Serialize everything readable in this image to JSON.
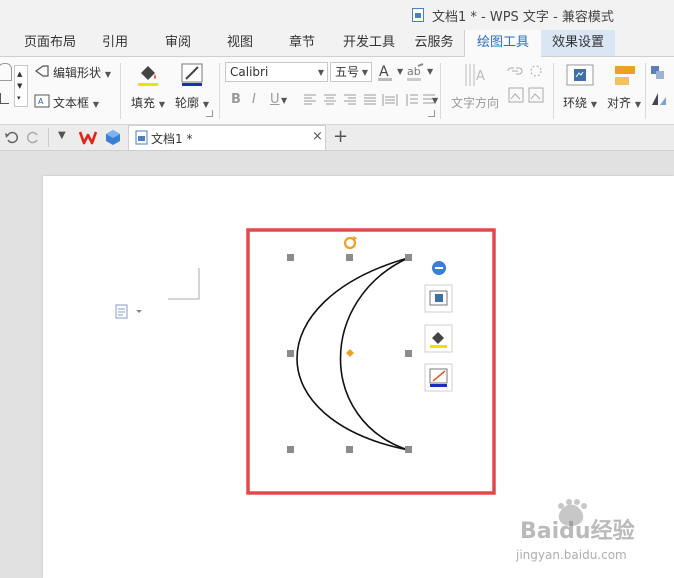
{
  "window": {
    "title": "文档1 * - WPS 文字 - 兼容模式"
  },
  "tabs": [
    {
      "label": "页面布局"
    },
    {
      "label": "引用"
    },
    {
      "label": "审阅"
    },
    {
      "label": "视图"
    },
    {
      "label": "章节"
    },
    {
      "label": "开发工具"
    },
    {
      "label": "云服务"
    },
    {
      "label": "绘图工具"
    },
    {
      "label": "效果设置"
    }
  ],
  "ribbon": {
    "edit_shape": "编辑形状",
    "text_box": "文本框",
    "fill": "填充",
    "outline": "轮廓",
    "font_name": "Calibri",
    "font_size": "五号",
    "text_direction": "文字方向",
    "wrap": "环绕",
    "align": "对齐"
  },
  "doc_tabs": {
    "doc_name": "文档1 *",
    "close": "×",
    "add": "+"
  },
  "colors": {
    "accent": "#2b6cc4",
    "selection_border": "#e04a4a",
    "handle": "#8c8c8c",
    "rotate": "#f0a020"
  },
  "watermark": {
    "brand": "Baidu经验",
    "url": "jingyan.baidu.com"
  }
}
